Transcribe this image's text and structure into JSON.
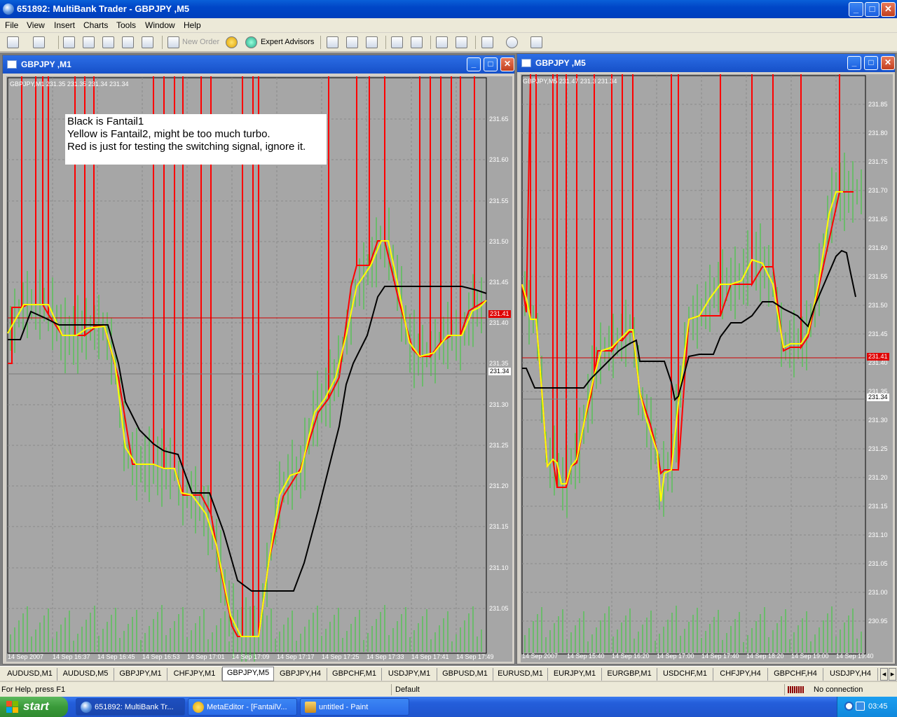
{
  "window": {
    "title": "651892: MultiBank Trader - GBPJPY ,M5",
    "minimize": "_",
    "restore": "□",
    "close": "✕"
  },
  "menu": [
    "File",
    "View",
    "Insert",
    "Charts",
    "Tools",
    "Window",
    "Help"
  ],
  "toolbar": {
    "new_order": "New Order",
    "expert_advisors": "Expert Advisors"
  },
  "chart_windows": [
    {
      "title": "GBPJPY ,M1",
      "ohlc": "GBPJPY,M1  231.35 231.35 231.34 231.34",
      "annotation": [
        "Black is Fantail1",
        "Yellow is Fantail2, might be too much turbo.",
        "Red is just for testing the switching signal, ignore it."
      ],
      "y_ticks": [
        "231.65",
        "231.60",
        "231.55",
        "231.50",
        "231.45",
        "231.40",
        "231.35",
        "231.30",
        "231.25",
        "231.20",
        "231.15",
        "231.10",
        "231.05"
      ],
      "x_ticks": [
        "14 Sep 2007",
        "14 Sep 16:37",
        "14 Sep 16:45",
        "14 Sep 16:53",
        "14 Sep 17:01",
        "14 Sep 17:09",
        "14 Sep 17:17",
        "14 Sep 17:25",
        "14 Sep 17:33",
        "14 Sep 17:41",
        "14 Sep 17:49"
      ],
      "price_red": "231.41",
      "price_white": "231.34"
    },
    {
      "title": "GBPJPY ,M5",
      "ohlc": "GBPJPY,M5  231.47 231.3  231.34",
      "y_ticks": [
        "231.85",
        "231.80",
        "231.75",
        "231.70",
        "231.65",
        "231.60",
        "231.55",
        "231.50",
        "231.45",
        "231.40",
        "231.35",
        "231.30",
        "231.25",
        "231.20",
        "231.15",
        "231.10",
        "231.05",
        "231.00",
        "230.95"
      ],
      "x_ticks": [
        "14 Sep 2007",
        "14 Sep 15:40",
        "14 Sep 16:20",
        "14 Sep 17:00",
        "14 Sep 17:40",
        "14 Sep 18:20",
        "14 Sep 19:00",
        "14 Sep 19:40"
      ],
      "price_red": "231.41",
      "price_white": "231.34"
    }
  ],
  "colors": {
    "chart_bg": "#a6a6a6",
    "bar": "#32cd32",
    "fantail1": "#000000",
    "fantail2": "#ffff00",
    "signal": "#ff0000"
  },
  "tabs": [
    "AUDUSD,M1",
    "AUDUSD,M5",
    "GBPJPY,M1",
    "CHFJPY,M1",
    "GBPJPY,M5",
    "GBPJPY,H4",
    "GBPCHF,M1",
    "USDJPY,M1",
    "GBPUSD,M1",
    "EURUSD,M1",
    "EURJPY,M1",
    "EURGBP,M1",
    "USDCHF,M1",
    "CHFJPY,H4",
    "GBPCHF,H4",
    "USDJPY,H4"
  ],
  "active_tab": "GBPJPY,M5",
  "status": {
    "help": "For Help, press F1",
    "profile": "Default",
    "connection": "No connection"
  },
  "taskbar": {
    "start": "start",
    "items": [
      "651892: MultiBank Tr...",
      "MetaEditor - [FantailV...",
      "untitled - Paint"
    ],
    "clock": "03:45"
  }
}
